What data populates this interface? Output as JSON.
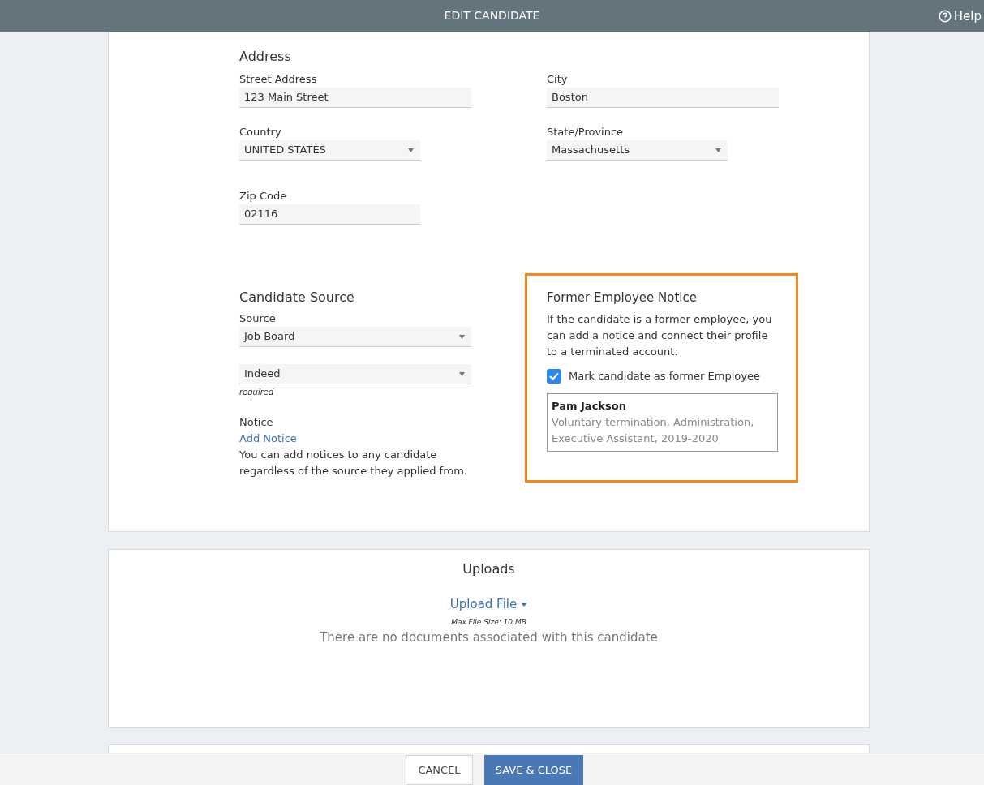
{
  "header": {
    "title": "EDIT CANDIDATE",
    "help": "Help"
  },
  "address": {
    "heading": "Address",
    "fields": [
      {
        "label": "Street Address",
        "value": "123 Main Street",
        "kind": "text"
      },
      {
        "label": "City",
        "value": "Boston",
        "kind": "text"
      },
      {
        "label": "Country",
        "value": "UNITED STATES",
        "kind": "select"
      },
      {
        "label": "State/Province",
        "value": "Massachusetts",
        "kind": "select"
      },
      {
        "label": "Zip Code",
        "value": "02116",
        "kind": "text"
      }
    ]
  },
  "source": {
    "heading": "Candidate Source",
    "label": "Source",
    "selects": [
      {
        "value": "Job Board"
      },
      {
        "value": "Indeed",
        "hint": "required"
      }
    ],
    "notice_label": "Notice",
    "add_notice": "Add Notice",
    "notice_text": "You can add notices to any candidate regardless of the source they applied from."
  },
  "former_notice": {
    "heading": "Former Employee Notice",
    "text": "If the candidate is a former employee, you can add a notice and connect their profile to a terminated account.",
    "checkbox": {
      "label": "Mark candidate as former Employee",
      "checked": true
    },
    "employee": {
      "name": "Pam Jackson",
      "details": "Voluntary termination, Administration, Executive Assistant, 2019-2020"
    }
  },
  "uploads": {
    "heading": "Uploads",
    "upload_button": "Upload File",
    "max_size": "Max File Size: 10 MB",
    "empty_text": "There are no documents associated with this candidate"
  },
  "footer": {
    "buttons": [
      {
        "label": "CANCEL",
        "kind": "secondary"
      },
      {
        "label": "SAVE & CLOSE",
        "kind": "primary"
      }
    ]
  }
}
